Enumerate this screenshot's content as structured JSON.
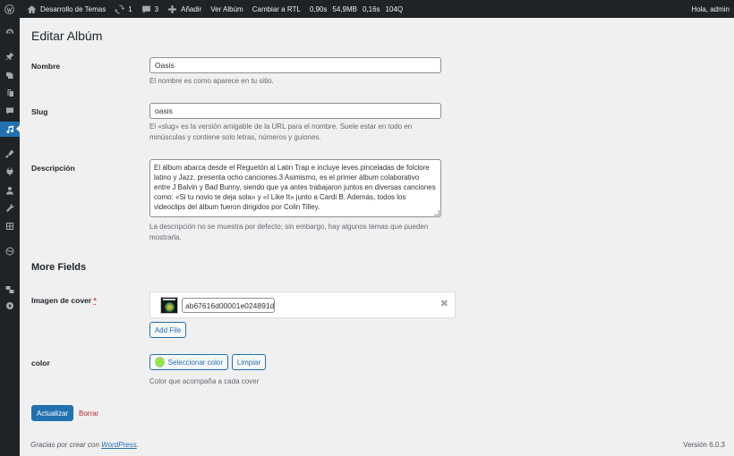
{
  "admin_bar": {
    "site_name": "Desarrollo de Temas",
    "updates_count": "1",
    "comments_count": "3",
    "new_label": "Añadir",
    "view_album": "Ver Albúm",
    "rtl": "Cambiar a RTL",
    "qm": [
      "0,90s",
      "54,9MB",
      "0,16s",
      "104Q"
    ],
    "greeting": "Hola, admin"
  },
  "sidebar": {
    "icons": [
      "dashboard-icon",
      "pin-icon",
      "media-icon",
      "pages-icon",
      "comments-icon",
      "music-icon",
      "appearance-icon",
      "plugins-icon",
      "users-icon",
      "tools-icon",
      "settings-icon",
      "globe-icon",
      "translate-icon",
      "play-icon"
    ]
  },
  "page": {
    "title": "Editar Albúm"
  },
  "form": {
    "name_label": "Nombre",
    "name_value": "Oasis",
    "name_desc": "El nombre es como aparece en tu sitio.",
    "slug_label": "Slug",
    "slug_value": "oasis",
    "slug_desc_1": "El «slug» es la versión amigable de la URL para el nombre. Suele estar en todo en",
    "slug_desc_2": "minúsculas y contiene solo letras, números y guiones.",
    "desc_label": "Descripción",
    "desc_value": "El álbum abarca desde el Reguetón al Latin Trap e incluye leves pinceladas de folclore latino y Jazz, presenta ocho canciones.3 Asimismo, es el primer álbum colaborativo entre J Balvin y Bad Bunny, siendo que ya antes trabajaron juntos en diversas canciones como: «Si tu novio te deja sola» y «I Like It» junto a Cardi B. Además, todos los videoclips del álbum fueron dirigidos por Colin Tilley.",
    "desc_help_1": "La descripción no se muestra por defecto; sin embargo, hay algunos temas que pueden",
    "desc_help_2": "mostrarla."
  },
  "more_fields": {
    "title": "More Fields",
    "cover_label": "Imagen de cover",
    "required_mark": "*",
    "cover_file_id": "ab67616d00001e024891d",
    "close_glyph": "✖",
    "add_file": "Add File",
    "color_label": "color",
    "color_button": "Seleccionar color",
    "color_value": "#8fe83a",
    "clear_button": "Limpiar",
    "color_desc": "Color que acompaña a cada cover"
  },
  "actions": {
    "update": "Actualizar",
    "delete": "Borrar"
  },
  "footer": {
    "thanks_prefix": "Gracias por crear con ",
    "wordpress": "WordPress",
    "thanks_suffix": ".",
    "version": "Versión 6.0.3"
  }
}
